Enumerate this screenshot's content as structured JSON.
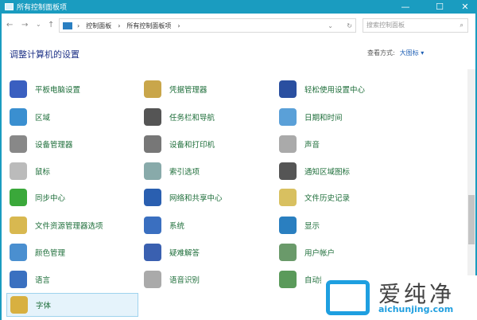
{
  "window": {
    "title": "所有控制面板项",
    "minimize": "—",
    "maximize": "☐",
    "close": "✕"
  },
  "nav": {
    "back": "←",
    "forward": "→",
    "recent": "⌄",
    "up": "↑",
    "breadcrumb": [
      "控制面板",
      "所有控制面板项"
    ],
    "sep": "›",
    "dropdown": "⌄",
    "refresh": "↻",
    "search_placeholder": "搜索控制面板",
    "search_icon": "⌕"
  },
  "header": {
    "title": "调整计算机的设置",
    "view_label": "查看方式:",
    "view_value": "大图标 ▾"
  },
  "items": [
    {
      "label": "平板电脑设置",
      "color": "#3a5fc0"
    },
    {
      "label": "凭据管理器",
      "color": "#c9a64a"
    },
    {
      "label": "轻松使用设置中心",
      "color": "#2a4fa0"
    },
    {
      "label": "区域",
      "color": "#3a8fd0"
    },
    {
      "label": "任务栏和导航",
      "color": "#555"
    },
    {
      "label": "日期和时间",
      "color": "#5aa0d8"
    },
    {
      "label": "设备管理器",
      "color": "#888"
    },
    {
      "label": "设备和打印机",
      "color": "#777"
    },
    {
      "label": "声音",
      "color": "#aaa"
    },
    {
      "label": "鼠标",
      "color": "#bbb"
    },
    {
      "label": "索引选项",
      "color": "#8aa"
    },
    {
      "label": "通知区域图标",
      "color": "#555"
    },
    {
      "label": "同步中心",
      "color": "#3aa83a"
    },
    {
      "label": "网络和共享中心",
      "color": "#2a5fb0"
    },
    {
      "label": "文件历史记录",
      "color": "#d8c060"
    },
    {
      "label": "文件资源管理器选项",
      "color": "#d8b850"
    },
    {
      "label": "系统",
      "color": "#3a6fc0"
    },
    {
      "label": "显示",
      "color": "#2a7fc0"
    },
    {
      "label": "颜色管理",
      "color": "#4a8fd0"
    },
    {
      "label": "疑难解答",
      "color": "#3a60b0"
    },
    {
      "label": "用户帐户",
      "color": "#6a9a6a"
    },
    {
      "label": "语言",
      "color": "#3a70c0"
    },
    {
      "label": "语音识别",
      "color": "#aaa"
    },
    {
      "label": "自动播放",
      "color": "#5a9a5a"
    },
    {
      "label": "字体",
      "color": "#d8b040"
    }
  ],
  "watermark": {
    "title": "爱纯净",
    "url": "aichunjing.com"
  }
}
